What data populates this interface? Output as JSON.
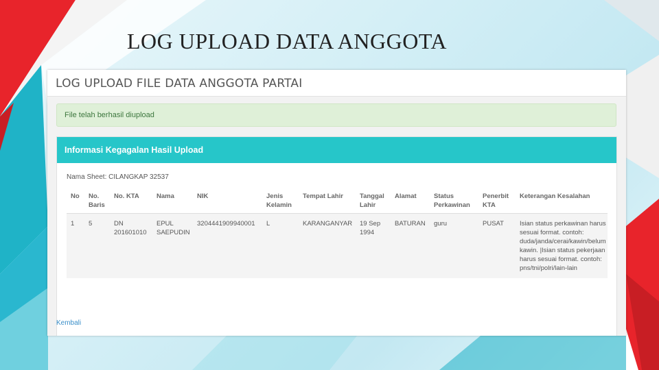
{
  "slide": {
    "title": "LOG UPLOAD DATA ANGGOTA"
  },
  "page": {
    "heading": "LOG UPLOAD FILE DATA ANGGOTA PARTAI"
  },
  "alert": {
    "message": "File telah berhasil diupload"
  },
  "panel": {
    "title": "Informasi Kegagalan Hasil Upload",
    "sheet_name": "Nama Sheet: CILANGKAP 32537"
  },
  "table": {
    "headers": [
      "No",
      "No. Baris",
      "No. KTA",
      "Nama",
      "NIK",
      "Jenis Kelamin",
      "Tempat Lahir",
      "Tanggal Lahir",
      "Alamat",
      "Status Perkawinan",
      "Penerbit KTA",
      "Keterangan Kesalahan"
    ],
    "rows": [
      [
        "1",
        "5",
        "DN 201601010",
        "EPUL SAEPUDIN",
        "3204441909940001",
        "L",
        "KARANGANYAR",
        "19 Sep 1994",
        "BATURAN",
        "guru",
        "PUSAT",
        "Isian status perkawinan harus sesuai format. contoh: duda/janda/cerai/kawin/belum kawin. |Isian status pekerjaan harus sesuai format. contoh: pns/tni/polri/lain-lain"
      ]
    ]
  },
  "scrollbar": {
    "left_arrow": "◀",
    "right_arrow": "▶"
  },
  "back_link": "Kembali",
  "colors": {
    "panel_header": "#26c6c9",
    "alert_bg": "#dff0d8",
    "accent_red": "#e8242b",
    "accent_teal": "#1fb3c7"
  }
}
